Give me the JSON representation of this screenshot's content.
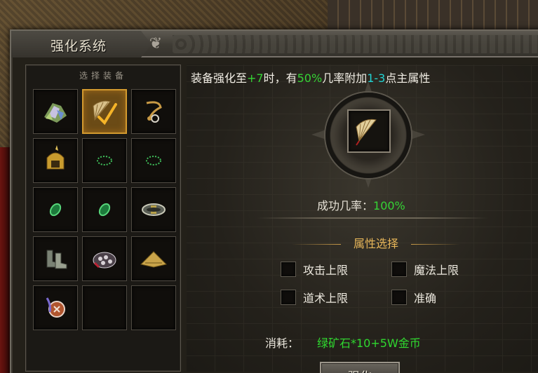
{
  "window": {
    "title": "强化系统"
  },
  "left_panel": {
    "header": "选择装备",
    "slots": [
      {
        "icon": "gem-cluster-icon",
        "filled": true,
        "selected": false
      },
      {
        "icon": "fan-icon",
        "filled": true,
        "selected": true
      },
      {
        "icon": "necklace-icon",
        "filled": true,
        "selected": false
      },
      {
        "icon": "helmet-icon",
        "filled": true,
        "selected": false
      },
      {
        "icon": "bracelet-icon",
        "filled": true,
        "selected": false
      },
      {
        "icon": "bracelet-icon",
        "filled": true,
        "selected": false
      },
      {
        "icon": "jade-ring-icon",
        "filled": true,
        "selected": false
      },
      {
        "icon": "jade-ring-icon",
        "filled": true,
        "selected": false
      },
      {
        "icon": "belt-icon",
        "filled": true,
        "selected": false
      },
      {
        "icon": "boots-icon",
        "filled": true,
        "selected": false
      },
      {
        "icon": "armor-icon",
        "filled": true,
        "selected": false
      },
      {
        "icon": "hat-icon",
        "filled": true,
        "selected": false
      },
      {
        "icon": "medal-icon",
        "filled": true,
        "selected": false
      },
      {
        "icon": "",
        "filled": false,
        "selected": false
      },
      {
        "icon": "",
        "filled": false,
        "selected": false
      }
    ]
  },
  "enhance": {
    "desc_prefix": "装备强化至",
    "level": "+7",
    "desc_mid1": "时，有",
    "chance": "50%",
    "desc_mid2": "几率附加",
    "range": "1-3",
    "desc_suffix": "点主属性",
    "target_icon": "fan-icon",
    "success_label": "成功几率：",
    "success_value": "100%"
  },
  "attributes": {
    "title": "属性选择",
    "options": [
      {
        "label": "攻击上限",
        "checked": false
      },
      {
        "label": "魔法上限",
        "checked": false
      },
      {
        "label": "道术上限",
        "checked": false
      },
      {
        "label": "准确",
        "checked": false
      }
    ]
  },
  "cost": {
    "label": "消耗：",
    "value": "绿矿石*10+5W金币"
  },
  "button": {
    "label": "强化"
  },
  "colors": {
    "highlight_green": "#35d335",
    "highlight_cyan": "#22d3d3",
    "gold": "#e7b659",
    "selected_slot": "#d39a2f"
  }
}
